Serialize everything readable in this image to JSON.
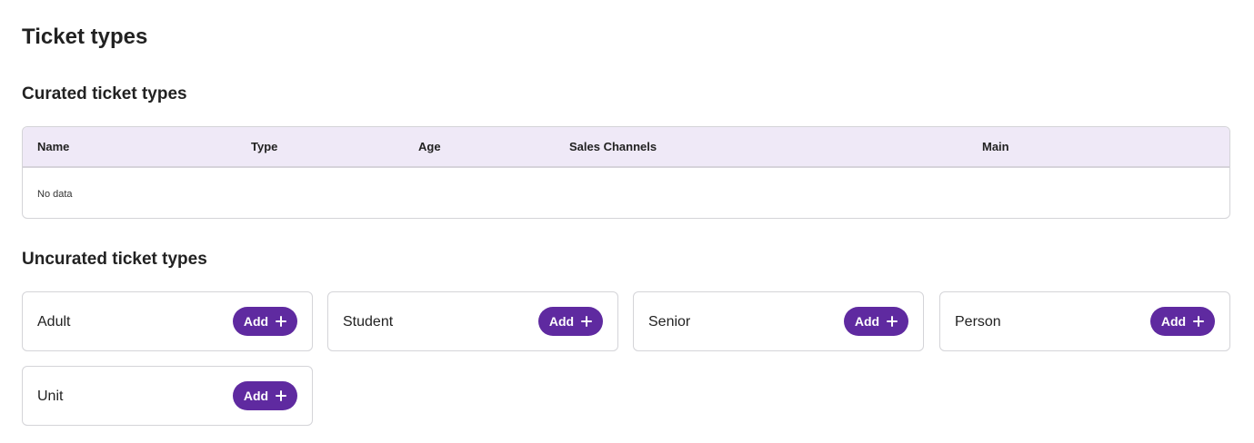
{
  "page": {
    "title": "Ticket types"
  },
  "curated": {
    "title": "Curated ticket types",
    "columns": {
      "name": "Name",
      "type": "Type",
      "age": "Age",
      "sales_channels": "Sales Channels",
      "main": "Main"
    },
    "empty_text": "No data"
  },
  "uncurated": {
    "title": "Uncurated ticket types",
    "add_label": "Add",
    "items": [
      {
        "label": "Adult"
      },
      {
        "label": "Student"
      },
      {
        "label": "Senior"
      },
      {
        "label": "Person"
      },
      {
        "label": "Unit"
      }
    ]
  },
  "colors": {
    "accent": "#5f2aa0",
    "table_header_bg": "#efe9f7"
  }
}
